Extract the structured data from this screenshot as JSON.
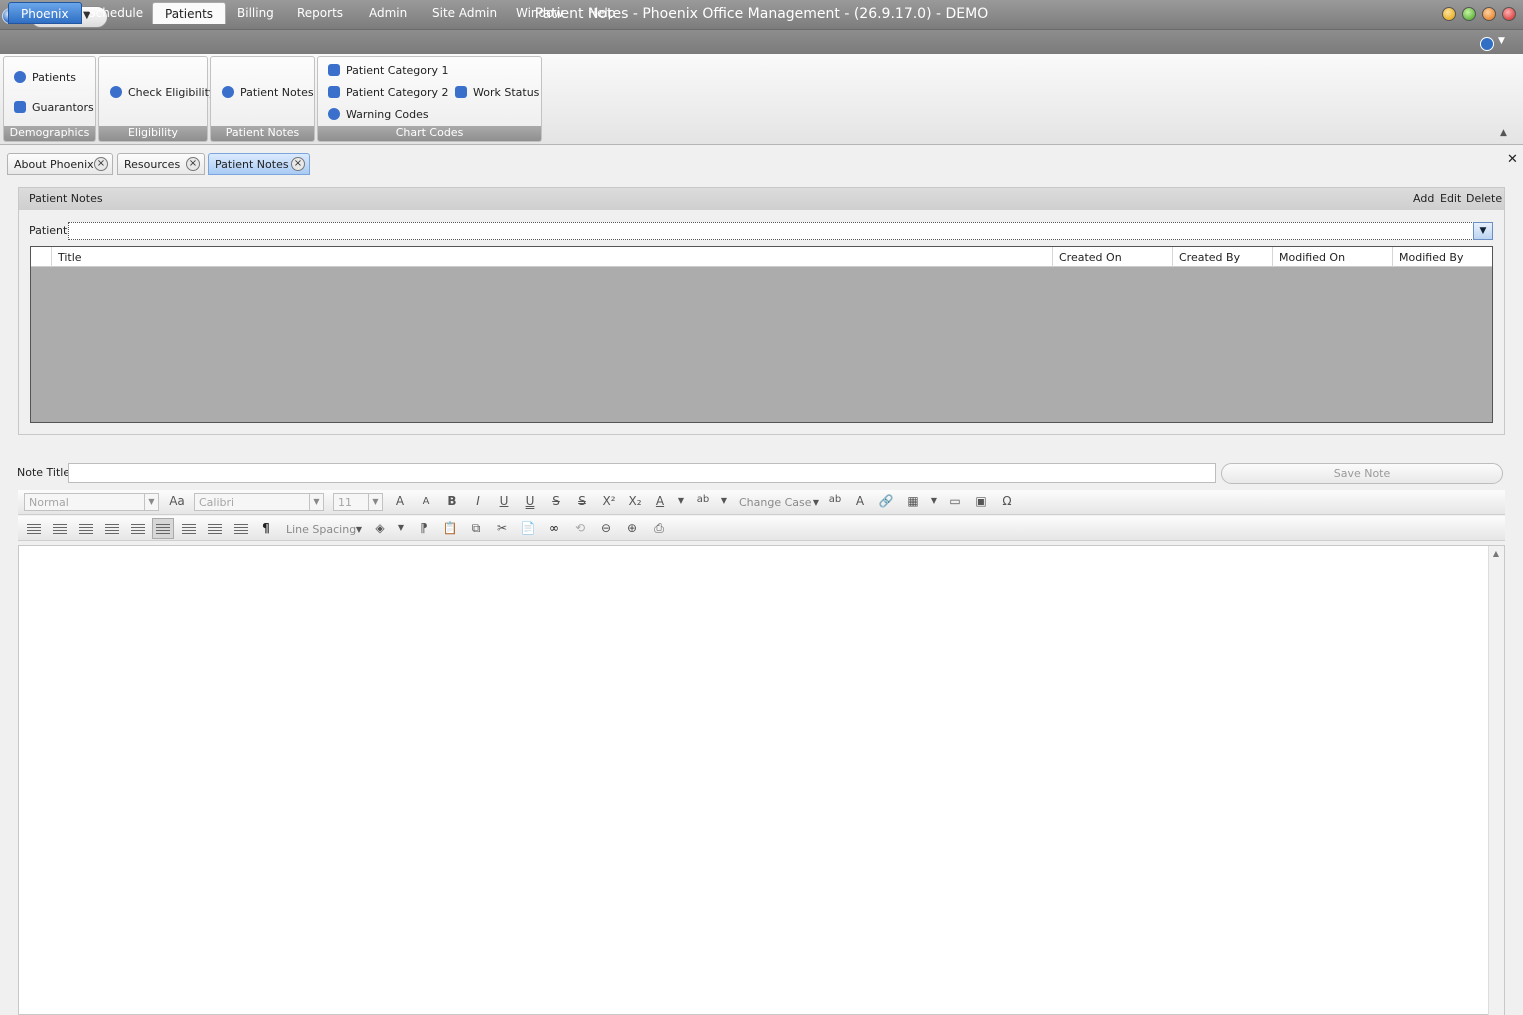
{
  "window": {
    "title": "Patient Notes - Phoenix Office Management - (26.9.17.0) - DEMO"
  },
  "colors": {
    "accent": "#2f6fc4",
    "titlebar": "#8a8a8a",
    "grid_bg": "#acacac"
  },
  "menu": {
    "tabs": [
      {
        "label": "Phoenix"
      },
      {
        "label": "Schedule"
      },
      {
        "label": "Patients"
      },
      {
        "label": "Billing"
      },
      {
        "label": "Reports"
      },
      {
        "label": "Admin"
      },
      {
        "label": "Site Admin"
      },
      {
        "label": "Window"
      },
      {
        "label": "Help"
      }
    ],
    "active": "Patients"
  },
  "ribbon": {
    "demographics": {
      "caption": "Demographics",
      "patients": "Patients",
      "guarantors": "Guarantors"
    },
    "eligibility": {
      "caption": "Eligibility",
      "check": "Check Eligibility"
    },
    "patient_notes": {
      "caption": "Patient Notes",
      "notes": "Patient Notes"
    },
    "chart_codes": {
      "caption": "Chart Codes",
      "cat1": "Patient Category 1",
      "cat2": "Patient Category 2",
      "warning": "Warning Codes",
      "work": "Work Status"
    }
  },
  "doc_tabs": [
    {
      "label": "About Phoenix"
    },
    {
      "label": "Resources"
    },
    {
      "label": "Patient Notes"
    }
  ],
  "panel": {
    "title": "Patient Notes",
    "actions": {
      "add": "Add",
      "edit": "Edit",
      "delete": "Delete"
    },
    "patient_label": "Patient",
    "patient_value": "",
    "columns": [
      "Title",
      "Created On",
      "Created By",
      "Modified On",
      "Modified By"
    ]
  },
  "note": {
    "title_label": "Note Title",
    "title_value": "",
    "save_label": "Save Note"
  },
  "toolbar": {
    "style_value": "Normal",
    "font_value": "Calibri",
    "size_value": "11",
    "change_case": "Change Case",
    "line_spacing": "Line Spacing"
  }
}
